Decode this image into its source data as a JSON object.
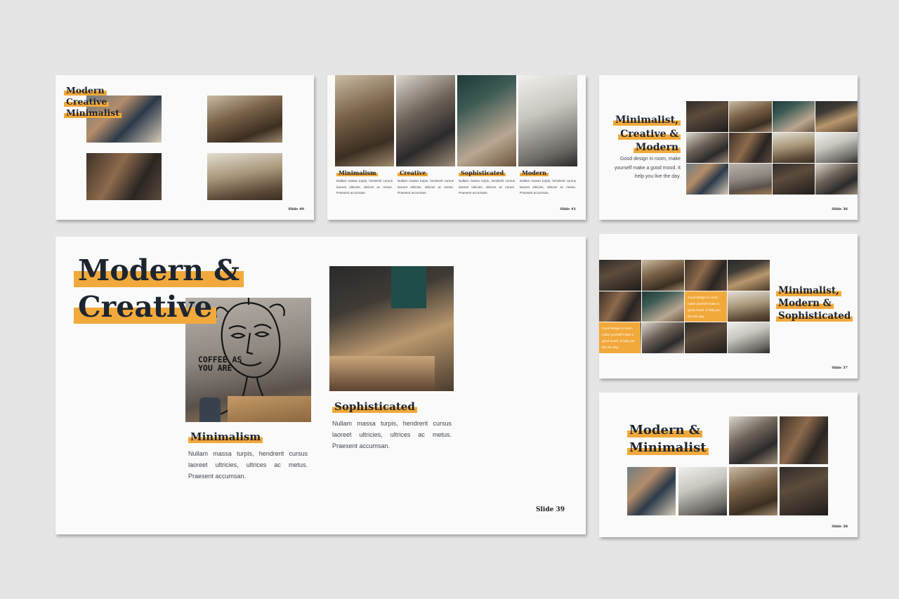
{
  "slides": {
    "s40": {
      "title": "Modern Creative Minimalist",
      "title_lines": [
        "Modern",
        "Creative",
        "Minimalist"
      ],
      "slide_label": "Slide 40"
    },
    "s41": {
      "cards": [
        {
          "heading": "Minimalism",
          "text": "Nullam massa turpis, hendrerit cursus laoreet ultricies, ultrices ac metus. Praesent accumsan."
        },
        {
          "heading": "Creative",
          "text": "Nullam massa turpis, hendrerit cursus laoreet ultricies, ultrices ac metus. Praesent accumsan."
        },
        {
          "heading": "Sophisticated",
          "text": "Nullam massa turpis, hendrerit cursus laoreet ultricies, ultrices ac metus. Praesent accumsan."
        },
        {
          "heading": "Modern",
          "text": "Nullam massa turpis, hendrerit cursus laoreet ultricies, ultrices ac metus. Praesent accumsan."
        }
      ],
      "slide_label": "Slide 41"
    },
    "s36": {
      "title_lines": [
        "Minimalist,",
        "Creative &",
        "Modern"
      ],
      "text": "Good design in room, make yourself make a good mood. It help you live the day.",
      "slide_label": "Slide 36"
    },
    "s39": {
      "title_line1": "Modern &",
      "title_line2": "Creative",
      "photo_caption": "COFFEE AS YOU ARE",
      "col1_heading": "Minimalism",
      "col1_text": "Nullam massa turpis, hendrerit cursus laoreet ultricies, ultrices ac metus. Praesent accumsan.",
      "col2_heading": "Sophisticated",
      "col2_text": "Nullam massa turpis, hendrerit cursus laoreet ultricies, ultrices ac metus. Praesent accumsan.",
      "slide_label": "Slide 39"
    },
    "s37": {
      "box1_text": "Good design in room, make yourself make a good mood. It help you live the day.",
      "box2_text": "Good design in room, make yourself make a good mood. It help you live the day.",
      "title_lines": [
        "Minimalist,",
        "Modern &",
        "Sophisticated"
      ],
      "slide_label": "Slide 37"
    },
    "s38": {
      "title_lines": [
        "Modern &",
        "Minimalist"
      ],
      "slide_label": "Slide 38"
    }
  },
  "colors": {
    "accent": "#f2a93b",
    "background": "#e6e5e6",
    "slide": "#fafafa",
    "title": "#1d2530"
  }
}
